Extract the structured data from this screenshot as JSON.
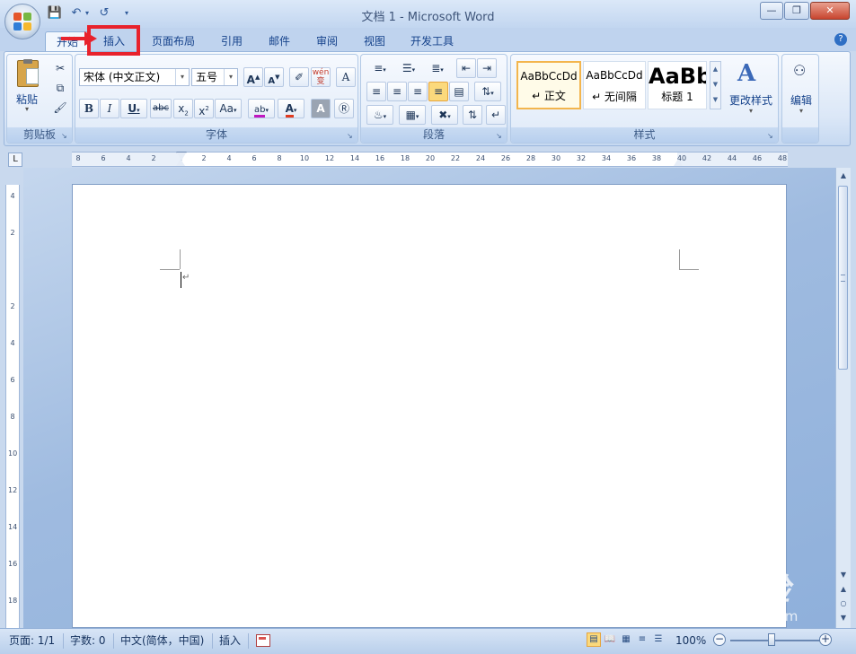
{
  "window": {
    "title": "文档 1 - Microsoft Word",
    "controls": {
      "minimize_icon": "minimize-icon",
      "maximize_icon": "maximize-icon",
      "close_icon": "close-icon"
    }
  },
  "quick_access": {
    "save": "save-icon",
    "undo": "undo-icon",
    "redo": "redo-icon",
    "customize": "customize-icon"
  },
  "tabs": [
    {
      "label": "开始"
    },
    {
      "label": "插入"
    },
    {
      "label": "页面布局"
    },
    {
      "label": "引用"
    },
    {
      "label": "邮件"
    },
    {
      "label": "审阅"
    },
    {
      "label": "视图"
    },
    {
      "label": "开发工具"
    }
  ],
  "active_tab": "开始",
  "highlight_color": "#e8222c",
  "ribbon": {
    "clipboard": {
      "label": "剪贴板",
      "paste_label": "粘贴"
    },
    "font": {
      "label": "字体",
      "font_name": "宋体 (中文正文)",
      "font_size": "五号",
      "wen_label": "wén 变"
    },
    "paragraph": {
      "label": "段落"
    },
    "styles": {
      "label": "样式",
      "cards": [
        {
          "sample": "AaBbCcDd",
          "name": "↵ 正文",
          "selected": true
        },
        {
          "sample": "AaBbCcDd",
          "name": "↵ 无间隔",
          "selected": false
        },
        {
          "sample": "AaBb",
          "name": "标题 1",
          "selected": false
        }
      ],
      "change_styles_label": "更改样式"
    },
    "editing": {
      "label": "编辑"
    }
  },
  "ruler": {
    "corner_symbol": "L",
    "h_ticks": [
      "8",
      "6",
      "4",
      "2",
      "",
      "2",
      "4",
      "6",
      "8",
      "10",
      "12",
      "14",
      "16",
      "18",
      "20",
      "22",
      "24",
      "26",
      "28",
      "30",
      "32",
      "34",
      "36",
      "38",
      "40",
      "42",
      "44",
      "46",
      "48"
    ],
    "v_ticks": [
      "4",
      "2",
      "",
      "2",
      "4",
      "6",
      "8",
      "10",
      "12",
      "14",
      "16",
      "18"
    ]
  },
  "document": {
    "paragraph_mark": "↵"
  },
  "watermark": {
    "brand": "Bai 经验",
    "url": "jingyan.baidu.com"
  },
  "status_bar": {
    "page": "页面: 1/1",
    "words": "字数: 0",
    "language": "中文(简体，中国)",
    "mode": "插入",
    "zoom": "100%",
    "zoom_level_percent": 100
  }
}
